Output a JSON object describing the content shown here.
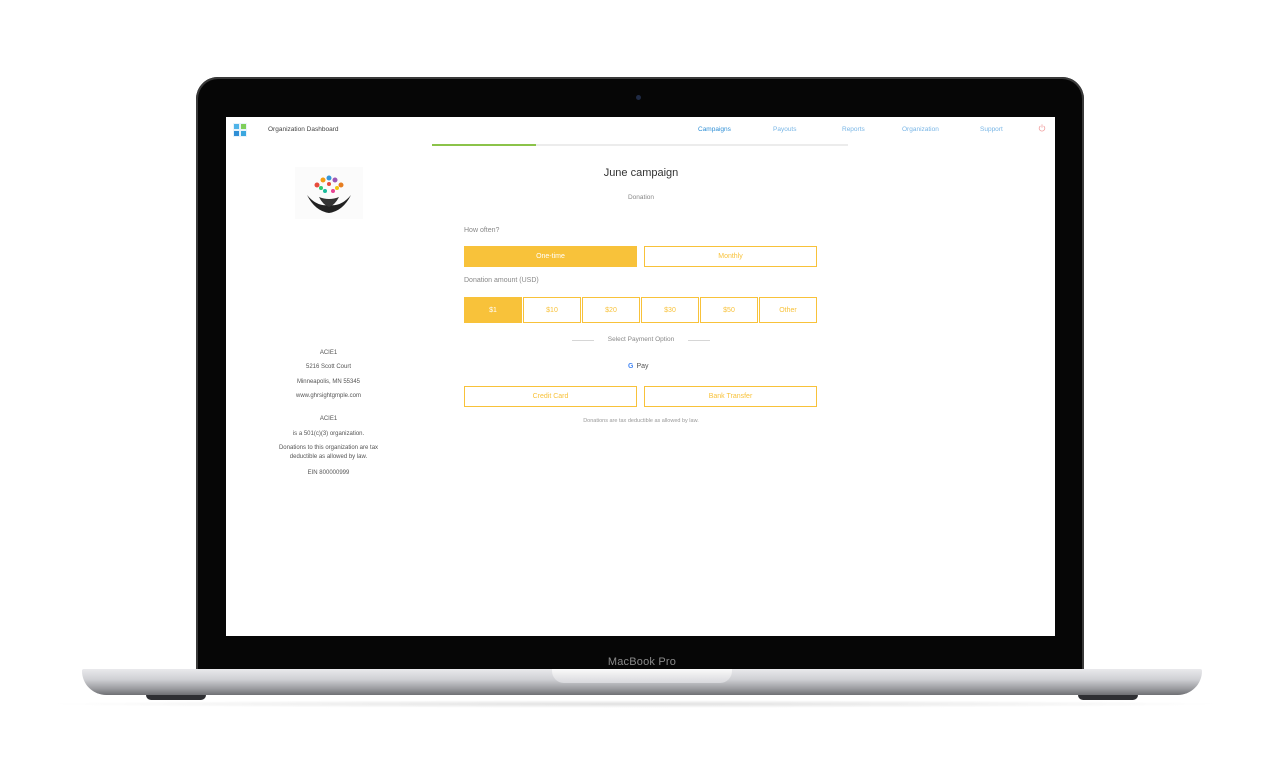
{
  "device": {
    "brand_label": "MacBook Pro"
  },
  "header": {
    "title": "Organization Dashboard",
    "nav": [
      "Campaigns",
      "Payouts",
      "Reports",
      "Organization",
      "Support"
    ],
    "active_nav": "Campaigns"
  },
  "progress": {
    "value_fraction": 0.25
  },
  "campaign": {
    "title": "June campaign",
    "subtitle": "Donation"
  },
  "frequency": {
    "label": "How often?",
    "options": [
      "One-time",
      "Monthly"
    ],
    "selected": "One-time"
  },
  "amount": {
    "label": "Donation amount (USD)",
    "options": [
      "$1",
      "$10",
      "$20",
      "$30",
      "$50",
      "Other"
    ],
    "selected": "$1"
  },
  "payment": {
    "label": "Select Payment Option",
    "gpay_label": "Pay",
    "methods": [
      "Credit Card",
      "Bank Transfer"
    ]
  },
  "footnote": "Donations are tax deductible as allowed by law.",
  "org": {
    "name": "ACIE1",
    "address1": "5216 Scott Court",
    "address2": "Minneapolis, MN 55345",
    "website": "www.ghrsightgmple.com",
    "name2": "ACIE1",
    "status": "is a 501(c)(3) organization.",
    "tax_note": "Donations to this organization are tax deductible as allowed by law.",
    "ein": "EIN 800000999"
  },
  "colors": {
    "accent": "#f8c23a",
    "nav_active": "#2f8fd6",
    "progress": "#8bc34a"
  }
}
